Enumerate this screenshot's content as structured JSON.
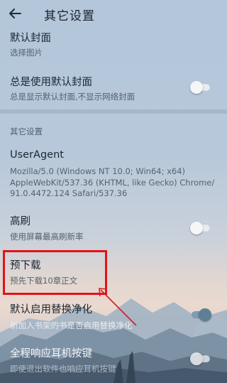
{
  "header": {
    "title": "其它设置",
    "back_icon": "arrow-left-icon"
  },
  "settings_top": [
    {
      "label": "默认封面",
      "desc": "选择图片"
    },
    {
      "label": "总是使用默认封面",
      "desc": "总是显示默认封面,不显示网络封面",
      "toggle": false
    }
  ],
  "section": {
    "title": "其它设置"
  },
  "settings_other": [
    {
      "label": "UserAgent",
      "desc": "Mozilla/5.0 (Windows NT 10.0; Win64; x64) AppleWebKit/537.36 (KHTML, like Gecko) Chrome/ 91.0.4472.124 Safari/537.36"
    },
    {
      "label": "高刷",
      "desc": "使用屏幕最高刷新率",
      "toggle": false
    },
    {
      "label": "预下载",
      "desc": "预先下载10章正文"
    },
    {
      "label": "默认启用替换净化",
      "desc": "新加入书架的书是否启用替换净化",
      "toggle": true
    },
    {
      "label": "全程响应耳机按键",
      "desc": "即使退出软件也响应耳机按键"
    }
  ],
  "annotation": {
    "box_color": "#e0131b",
    "arrow_color": "#d81b22"
  }
}
